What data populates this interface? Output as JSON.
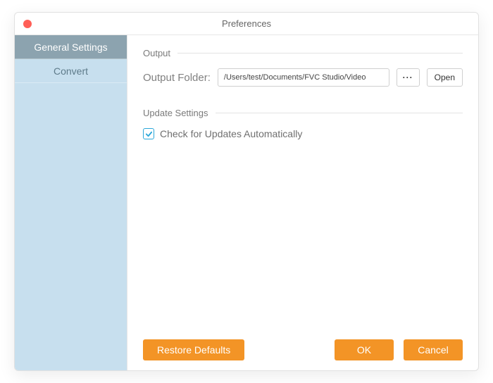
{
  "window": {
    "title": "Preferences"
  },
  "sidebar": {
    "items": [
      {
        "label": "General Settings",
        "active": true
      },
      {
        "label": "Convert",
        "active": false
      }
    ]
  },
  "sections": {
    "output": {
      "heading": "Output",
      "folder_label": "Output Folder:",
      "folder_path": "/Users/test/Documents/FVC Studio/Video",
      "browse_label": "···",
      "open_label": "Open"
    },
    "update": {
      "heading": "Update Settings",
      "auto_check_label": "Check for Updates Automatically",
      "auto_check_value": true
    }
  },
  "footer": {
    "restore_label": "Restore Defaults",
    "ok_label": "OK",
    "cancel_label": "Cancel"
  },
  "colors": {
    "accent": "#f39426",
    "sidebar_bg": "#c7dfee",
    "sidebar_active": "#8ca3af",
    "checkbox": "#2aa7d9"
  }
}
